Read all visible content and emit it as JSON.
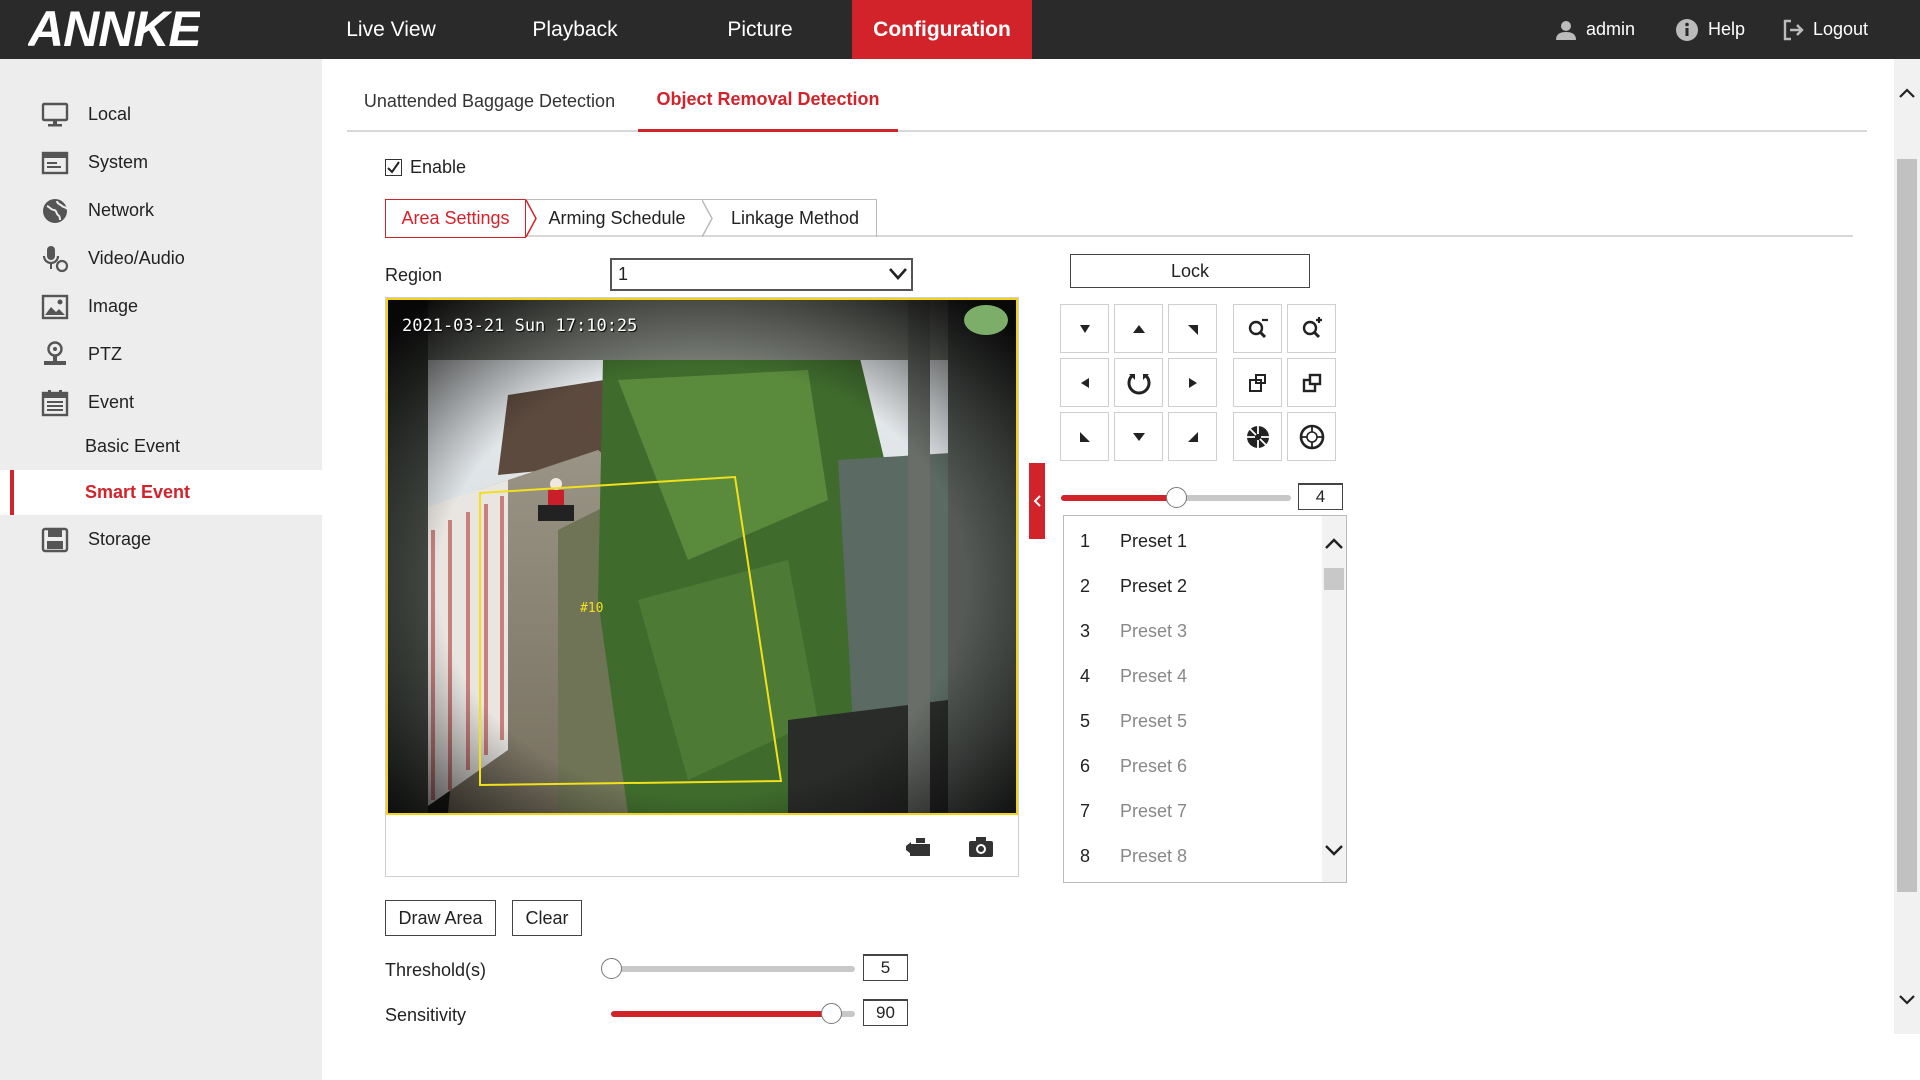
{
  "brand": {
    "logo_text": "ANNKE",
    "accent": "#d2232a",
    "header_bg": "#2a2a2a"
  },
  "nav": {
    "items": [
      {
        "label": "Live View"
      },
      {
        "label": "Playback"
      },
      {
        "label": "Picture"
      },
      {
        "label": "Configuration",
        "active": true
      }
    ],
    "user": "admin",
    "help": "Help",
    "logout": "Logout"
  },
  "sidebar": {
    "items": [
      {
        "label": "Local",
        "icon": "monitor-icon"
      },
      {
        "label": "System",
        "icon": "system-icon"
      },
      {
        "label": "Network",
        "icon": "globe-icon"
      },
      {
        "label": "Video/Audio",
        "icon": "microphone-icon"
      },
      {
        "label": "Image",
        "icon": "image-icon"
      },
      {
        "label": "PTZ",
        "icon": "ptz-icon"
      },
      {
        "label": "Event",
        "icon": "calendar-icon"
      }
    ],
    "sub_items": [
      {
        "label": "Basic Event"
      },
      {
        "label": "Smart Event",
        "active": true
      }
    ],
    "storage": {
      "label": "Storage",
      "icon": "storage-icon"
    }
  },
  "tabs": {
    "items": [
      {
        "label": "Unattended Baggage Detection"
      },
      {
        "label": "Object Removal Detection",
        "active": true
      }
    ]
  },
  "enable": {
    "label": "Enable",
    "checked": true
  },
  "sub_tabs": {
    "items": [
      {
        "label": "Area Settings",
        "active": true
      },
      {
        "label": "Arming Schedule"
      },
      {
        "label": "Linkage Method"
      }
    ]
  },
  "region": {
    "label": "Region",
    "value": "1"
  },
  "video": {
    "osd_timestamp": "2021-03-21 Sun 17:10:25",
    "area_label": "#10"
  },
  "buttons": {
    "draw_area": "Draw Area",
    "clear": "Clear",
    "lock": "Lock"
  },
  "threshold": {
    "label": "Threshold(s)",
    "value": "5",
    "fraction": 0.0
  },
  "sensitivity": {
    "label": "Sensitivity",
    "value": "90",
    "fraction": 0.9
  },
  "ptz": {
    "speed": "4",
    "speed_fraction": 0.5
  },
  "presets": [
    {
      "num": "1",
      "name": "Preset 1",
      "set": true
    },
    {
      "num": "2",
      "name": "Preset 2",
      "set": true
    },
    {
      "num": "3",
      "name": "Preset 3",
      "set": false
    },
    {
      "num": "4",
      "name": "Preset 4",
      "set": false
    },
    {
      "num": "5",
      "name": "Preset 5",
      "set": false
    },
    {
      "num": "6",
      "name": "Preset 6",
      "set": false
    },
    {
      "num": "7",
      "name": "Preset 7",
      "set": false
    },
    {
      "num": "8",
      "name": "Preset 8",
      "set": false
    }
  ]
}
